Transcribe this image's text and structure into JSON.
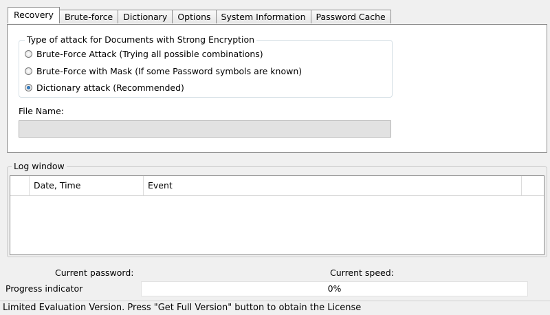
{
  "tabs": [
    "Recovery",
    "Brute-force",
    "Dictionary",
    "Options",
    "System Information",
    "Password Cache"
  ],
  "recovery": {
    "group_title": "Type of attack for Documents with Strong Encryption",
    "options": [
      {
        "label": "Brute-Force Attack (Trying all possible combinations)",
        "checked": false
      },
      {
        "label": "Brute-Force with Mask (If some Password symbols are known)",
        "checked": false
      },
      {
        "label": "Dictionary attack (Recommended)",
        "checked": true
      }
    ],
    "file_name_label": "File Name:",
    "file_name_value": ""
  },
  "log": {
    "title": "Log window",
    "columns": [
      "Date, Time",
      "Event"
    ]
  },
  "status": {
    "current_password_label": "Current password:",
    "current_speed_label": "Current speed:",
    "progress_label": "Progress indicator",
    "progress_text": "0%",
    "progress_value": 0
  },
  "statusbar_text": "Limited Evaluation Version. Press \"Get Full Version\" button to obtain the License"
}
